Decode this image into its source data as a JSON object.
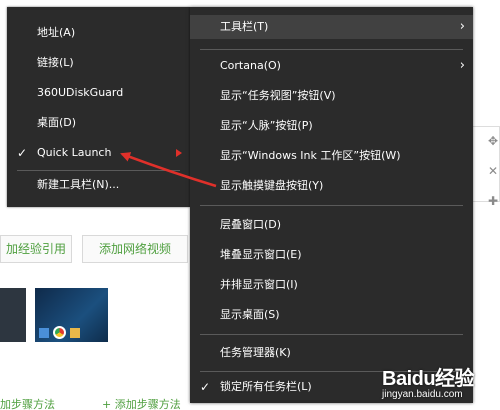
{
  "background": {
    "button_a": "加经验引用",
    "button_b": "添加网络视频",
    "bottom_left_text": "加步骤方法",
    "bottom_mid_text": "+ 添加步骤方法",
    "side_icons": [
      "crosshair-icon",
      "close-icon",
      "plus-icon"
    ]
  },
  "submenu": {
    "items": [
      {
        "label": "地址(A)"
      },
      {
        "label": "链接(L)"
      },
      {
        "label": "360UDiskGuard"
      },
      {
        "label": "桌面(D)"
      },
      {
        "label": "Quick Launch",
        "checked": true,
        "has_submenu": true
      },
      {
        "label": "新建工具栏(N)..."
      }
    ]
  },
  "mainmenu": {
    "items": [
      {
        "label": "工具栏(T)",
        "has_submenu": true,
        "highlighted": true
      },
      {
        "label": "Cortana(O)",
        "has_submenu": true
      },
      {
        "label": "显示“任务视图”按钮(V)"
      },
      {
        "label": "显示“人脉”按钮(P)"
      },
      {
        "label": "显示“Windows Ink 工作区”按钮(W)"
      },
      {
        "label": "显示触摸键盘按钮(Y)"
      },
      {
        "label": "层叠窗口(D)"
      },
      {
        "label": "堆叠显示窗口(E)"
      },
      {
        "label": "并排显示窗口(I)"
      },
      {
        "label": "显示桌面(S)"
      },
      {
        "label": "任务管理器(K)"
      },
      {
        "label": "锁定所有任务栏(L)",
        "checked": true
      }
    ]
  },
  "watermark": {
    "logo": "Baidu经验",
    "url": "jingyan.baidu.com"
  },
  "colors": {
    "menu_bg": "#2b2b2b",
    "menu_highlight": "#414141",
    "arrow": "#e0302a",
    "bg_accent": "#4f9f3f"
  }
}
